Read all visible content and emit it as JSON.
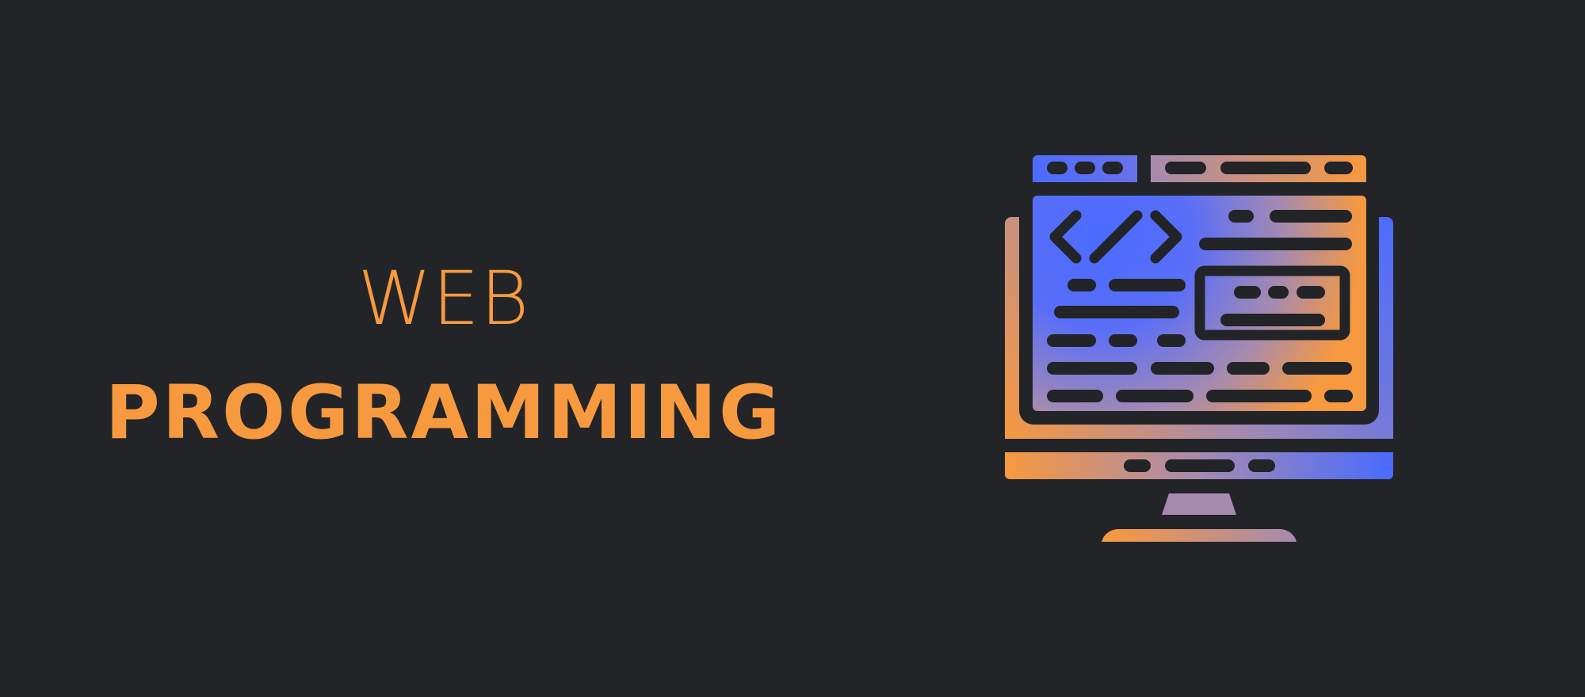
{
  "banner": {
    "title_line1": "WEB",
    "title_line2": "PROGRAMMING"
  },
  "colors": {
    "background": "#222428",
    "accent_orange": "#f7993f",
    "accent_blue": "#4a6bff",
    "dark_detail": "#222428"
  },
  "illustration": {
    "icon": "code-monitor-icon"
  }
}
